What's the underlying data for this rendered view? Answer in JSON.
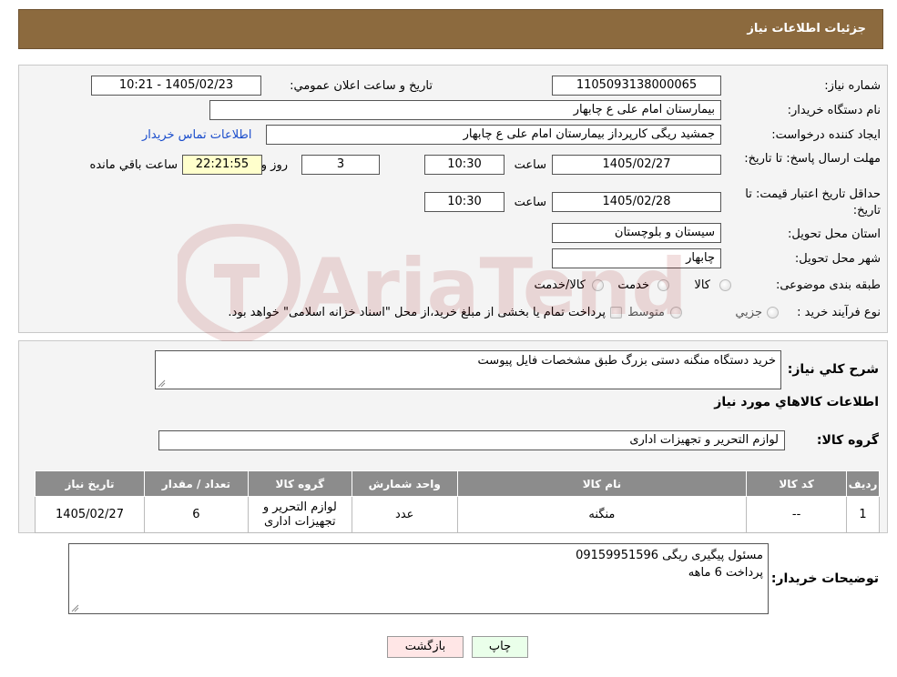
{
  "header": {
    "title": "جزئیات اطلاعات نیاز"
  },
  "details": {
    "need_number_label": "شماره نیاز:",
    "need_number": "1105093138000065",
    "announce_label": "تاریخ و ساعت اعلان عمومي:",
    "announce_value": "1405/02/23 - 10:21",
    "buyer_org_label": "نام دستگاه خريدار:",
    "buyer_org": "بيمارستان امام علی  ع  چابهار",
    "requester_label": "ايجاد کننده درخواست:",
    "requester": "جمشید ریگی کارپرداز بیمارستان امام علی  ع  چابهار",
    "contact_link": "اطلاعات تماس خريدار",
    "deadline_label": "مهلت ارسال پاسخ: تا تاريخ:",
    "deadline_date": "1405/02/27",
    "time_label": "ساعت",
    "deadline_time": "10:30",
    "days": "3",
    "days_label": "روز و",
    "remaining_time": "22:21:55",
    "remaining_label": "ساعت باقي مانده",
    "validity_label": "حداقل تاريخ اعتبار قيمت: تا تاريخ:",
    "validity_date": "1405/02/28",
    "validity_time": "10:30",
    "province_label": "استان محل تحويل:",
    "province": "سيستان و بلوچستان",
    "city_label": "شهر محل تحويل:",
    "city": "چابهار",
    "category_label": "طبقه بندی موضوعی:",
    "category_options": [
      "کالا",
      "خدمت",
      "کالا/خدمت"
    ],
    "process_label": "نوع فرآيند خريد :",
    "process_options": [
      "جزيي",
      "متوسط"
    ],
    "process_note": "پرداخت تمام يا بخشی از مبلغ خريد،از محل \"اسناد خزانه اسلامی\" خواهد بود."
  },
  "summary": {
    "desc_label": "شرح کلي نياز:",
    "desc": "خرید دستگاه منگنه دستی بزرگ طبق مشخصات فایل پیوست",
    "goods_info_title": "اطلاعات کالاهاي مورد نياز",
    "goods_group_label": "گروه کالا:",
    "goods_group": "لوازم التحرير و تجهيزات اداری"
  },
  "table": {
    "headers": [
      "رديف",
      "کد کالا",
      "نام کالا",
      "واحد شمارش",
      "گروه کالا",
      "تعداد / مقدار",
      "تاريخ نياز"
    ],
    "rows": [
      [
        "1",
        "--",
        "منگنه",
        "عدد",
        "لوازم التحرير و تجهيزات اداری",
        "6",
        "1405/02/27"
      ]
    ]
  },
  "buyer_notes": {
    "label": "توضيحات خريدار:",
    "line1": "مسئول پیگیری ریگی 09159951596",
    "line2": "پرداخت 6 ماهه"
  },
  "buttons": {
    "print": "چاپ",
    "back": "بازگشت"
  },
  "watermark": {
    "text": "AriaTender.neT"
  },
  "colors": {
    "header_bg": "#8c6a3e",
    "link": "#1a4dcc",
    "print_bg": "#eaffea",
    "back_bg": "#ffe6e6"
  }
}
